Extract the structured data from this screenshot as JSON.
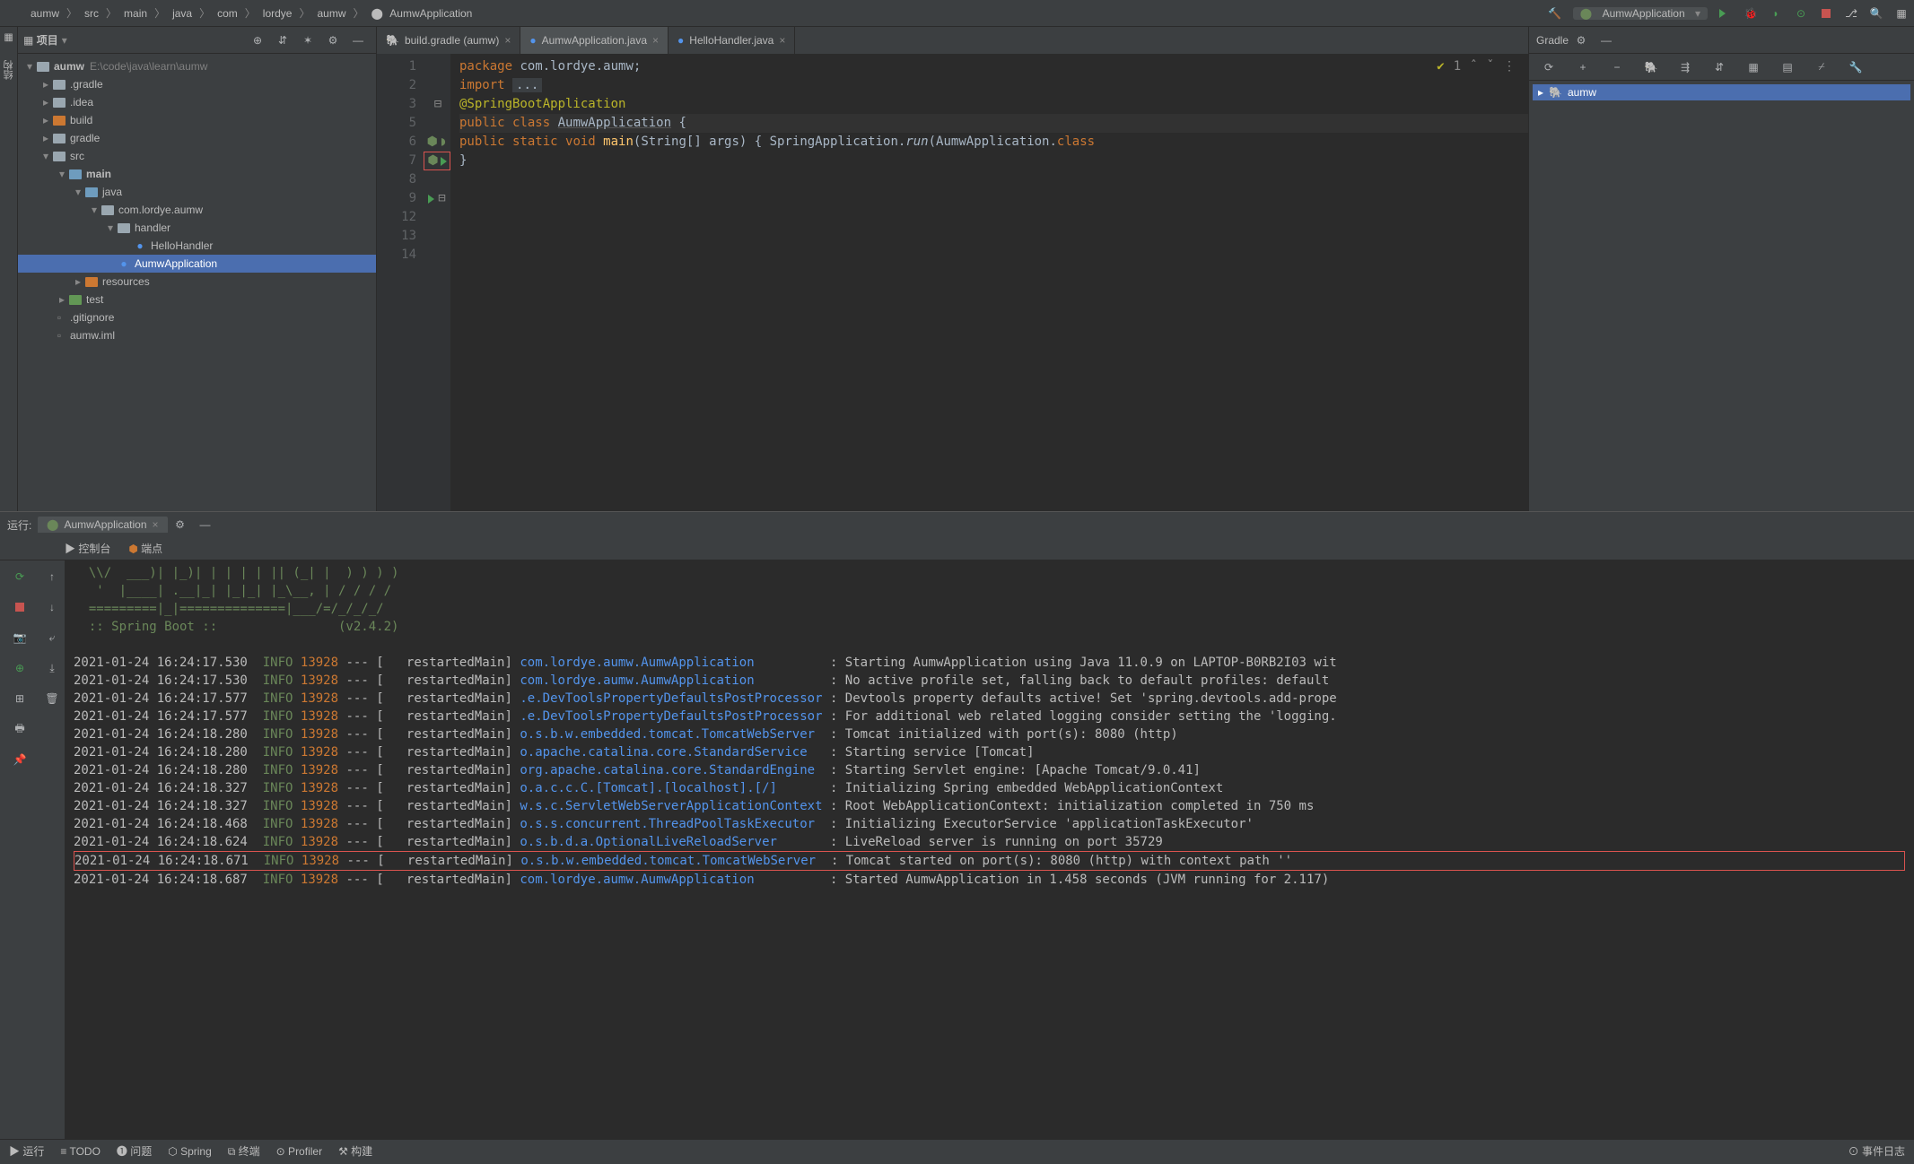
{
  "breadcrumbs": [
    "aumw",
    "src",
    "main",
    "java",
    "com",
    "lordye",
    "aumw",
    "AumwApplication"
  ],
  "run_config": "AumwApplication",
  "project": {
    "label": "项目",
    "root": {
      "name": "aumw",
      "path": "E:\\code\\java\\learn\\aumw"
    },
    "nodes": [
      {
        "name": ".gradle",
        "depth": 1,
        "arrow": "▸",
        "folder": "gray"
      },
      {
        "name": ".idea",
        "depth": 1,
        "arrow": "▸",
        "folder": "gray"
      },
      {
        "name": "build",
        "depth": 1,
        "arrow": "▸",
        "folder": "orange"
      },
      {
        "name": "gradle",
        "depth": 1,
        "arrow": "▸",
        "folder": "gray"
      },
      {
        "name": "src",
        "depth": 1,
        "arrow": "▾",
        "folder": "gray"
      },
      {
        "name": "main",
        "depth": 2,
        "arrow": "▾",
        "folder": "blue",
        "bold": true
      },
      {
        "name": "java",
        "depth": 3,
        "arrow": "▾",
        "folder": "blue"
      },
      {
        "name": "com.lordye.aumw",
        "depth": 4,
        "arrow": "▾",
        "folder": "gray"
      },
      {
        "name": "handler",
        "depth": 5,
        "arrow": "▾",
        "folder": "gray"
      },
      {
        "name": "HelloHandler",
        "depth": 6,
        "arrow": "",
        "icon": "class"
      },
      {
        "name": "AumwApplication",
        "depth": 5,
        "arrow": "",
        "icon": "class",
        "sel": true
      },
      {
        "name": "resources",
        "depth": 3,
        "arrow": "▸",
        "folder": "orange"
      },
      {
        "name": "test",
        "depth": 2,
        "arrow": "▸",
        "folder": "green"
      },
      {
        "name": ".gitignore",
        "depth": 1,
        "arrow": "",
        "icon": "file"
      },
      {
        "name": "aumw.iml",
        "depth": 1,
        "arrow": "",
        "icon": "file"
      }
    ]
  },
  "tabs": [
    {
      "label": "build.gradle (aumw)",
      "icon": "elephant",
      "active": false
    },
    {
      "label": "AumwApplication.java",
      "icon": "class",
      "active": true
    },
    {
      "label": "HelloHandler.java",
      "icon": "class",
      "active": false
    }
  ],
  "code_status": {
    "checks": "1"
  },
  "code": {
    "lines": [
      {
        "n": 1,
        "html": "<span class='kw'>package</span> <span class='pkg'>com.lordye.aumw</span>;"
      },
      {
        "n": 2,
        "html": ""
      },
      {
        "n": 3,
        "html": "<span class='kw'>import</span> <span style='background:#3b3f42;padding:0 4px;'>...</span>",
        "fold": true
      },
      {
        "n": 5,
        "html": ""
      },
      {
        "n": 6,
        "html": "<span class='ann'>@SpringBootApplication</span>",
        "icons": "spring"
      },
      {
        "n": 7,
        "html": "<span class='kw'>public class</span> <span class='cls underline'>AumwApplication</span> {",
        "icons": "run",
        "hl": true
      },
      {
        "n": 8,
        "html": ""
      },
      {
        "n": 9,
        "html": "    <span class='kw'>public static</span> <span class='kw'>void</span> <span class='id'>main</span>(String[] args) {  SpringApplication.<span class='it'>run</span>(AumwApplication.<span class='kw'>class</span>",
        "icons": "play",
        "fold": true
      },
      {
        "n": 12,
        "html": ""
      },
      {
        "n": 13,
        "html": "}"
      },
      {
        "n": 14,
        "html": ""
      }
    ]
  },
  "gradle": {
    "title": "Gradle",
    "root": "aumw"
  },
  "run": {
    "label": "运行:",
    "tab": "AumwApplication",
    "subtabs": [
      "控制台",
      "端点"
    ],
    "banner": [
      "  \\\\/  ___)| |_)| | | | | || (_| |  ) ) ) )",
      "   '  |____| .__|_| |_|_| |_\\__, | / / / /",
      "  =========|_|==============|___/=/_/_/_/",
      "  :: Spring Boot ::                (v2.4.2)"
    ],
    "logs": [
      {
        "ts": "2021-01-24 16:24:17.530",
        "lvl": "INFO",
        "pid": "13928",
        "thread": "restartedMain",
        "logger": "com.lordye.aumw.AumwApplication",
        "msg": "Starting AumwApplication using Java 11.0.9 on LAPTOP-B0RB2I03 wit"
      },
      {
        "ts": "2021-01-24 16:24:17.530",
        "lvl": "INFO",
        "pid": "13928",
        "thread": "restartedMain",
        "logger": "com.lordye.aumw.AumwApplication",
        "msg": "No active profile set, falling back to default profiles: default"
      },
      {
        "ts": "2021-01-24 16:24:17.577",
        "lvl": "INFO",
        "pid": "13928",
        "thread": "restartedMain",
        "logger": ".e.DevToolsPropertyDefaultsPostProcessor",
        "msg": "Devtools property defaults active! Set 'spring.devtools.add-prope"
      },
      {
        "ts": "2021-01-24 16:24:17.577",
        "lvl": "INFO",
        "pid": "13928",
        "thread": "restartedMain",
        "logger": ".e.DevToolsPropertyDefaultsPostProcessor",
        "msg": "For additional web related logging consider setting the 'logging."
      },
      {
        "ts": "2021-01-24 16:24:18.280",
        "lvl": "INFO",
        "pid": "13928",
        "thread": "restartedMain",
        "logger": "o.s.b.w.embedded.tomcat.TomcatWebServer",
        "msg": "Tomcat initialized with port(s): 8080 (http)"
      },
      {
        "ts": "2021-01-24 16:24:18.280",
        "lvl": "INFO",
        "pid": "13928",
        "thread": "restartedMain",
        "logger": "o.apache.catalina.core.StandardService",
        "msg": "Starting service [Tomcat]"
      },
      {
        "ts": "2021-01-24 16:24:18.280",
        "lvl": "INFO",
        "pid": "13928",
        "thread": "restartedMain",
        "logger": "org.apache.catalina.core.StandardEngine",
        "msg": "Starting Servlet engine: [Apache Tomcat/9.0.41]"
      },
      {
        "ts": "2021-01-24 16:24:18.327",
        "lvl": "INFO",
        "pid": "13928",
        "thread": "restartedMain",
        "logger": "o.a.c.c.C.[Tomcat].[localhost].[/]",
        "msg": "Initializing Spring embedded WebApplicationContext"
      },
      {
        "ts": "2021-01-24 16:24:18.327",
        "lvl": "INFO",
        "pid": "13928",
        "thread": "restartedMain",
        "logger": "w.s.c.ServletWebServerApplicationContext",
        "msg": "Root WebApplicationContext: initialization completed in 750 ms"
      },
      {
        "ts": "2021-01-24 16:24:18.468",
        "lvl": "INFO",
        "pid": "13928",
        "thread": "restartedMain",
        "logger": "o.s.s.concurrent.ThreadPoolTaskExecutor",
        "msg": "Initializing ExecutorService 'applicationTaskExecutor'"
      },
      {
        "ts": "2021-01-24 16:24:18.624",
        "lvl": "INFO",
        "pid": "13928",
        "thread": "restartedMain",
        "logger": "o.s.b.d.a.OptionalLiveReloadServer",
        "msg": "LiveReload server is running on port 35729"
      },
      {
        "ts": "2021-01-24 16:24:18.671",
        "lvl": "INFO",
        "pid": "13928",
        "thread": "restartedMain",
        "logger": "o.s.b.w.embedded.tomcat.TomcatWebServer",
        "msg": "Tomcat started on port(s): 8080 (http) with context path ''",
        "hl": true
      },
      {
        "ts": "2021-01-24 16:24:18.687",
        "lvl": "INFO",
        "pid": "13928",
        "thread": "restartedMain",
        "logger": "com.lordye.aumw.AumwApplication",
        "msg": "Started AumwApplication in 1.458 seconds (JVM running for 2.117)"
      }
    ]
  },
  "statusbar": {
    "items": [
      "▶ 运行",
      "≡ TODO",
      "❶ 问题",
      "⬡ Spring",
      "⧉ 终端",
      "⊙ Profiler",
      "⚒ 构建"
    ],
    "right": "⊙ 事件日志"
  }
}
